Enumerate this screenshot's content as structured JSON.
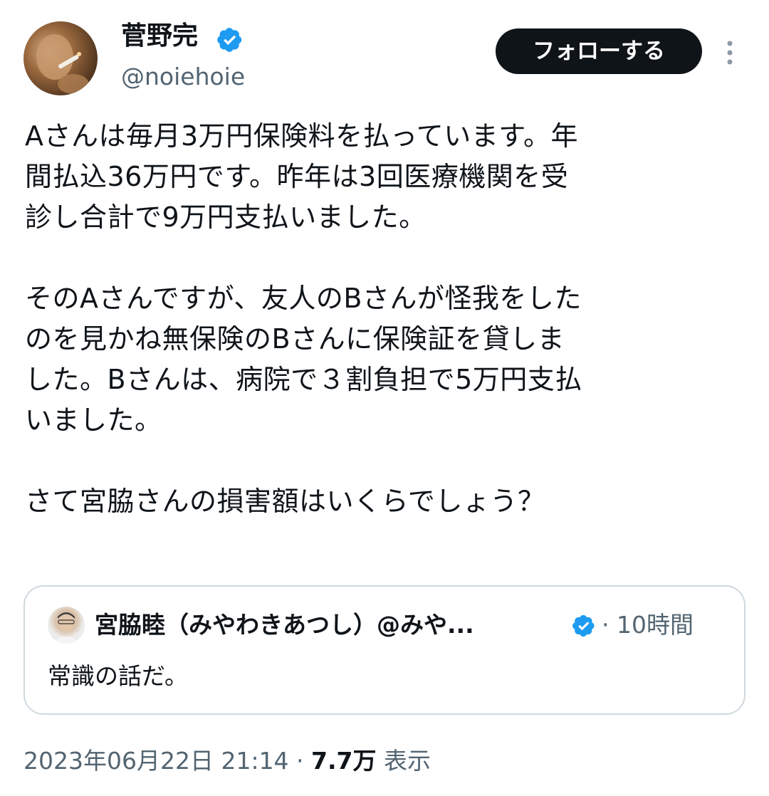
{
  "tweet": {
    "author_name": "菅野完",
    "handle": "@noiehoie",
    "verified": true,
    "follow_label": "フォローする",
    "paragraphs": [
      "Aさんは毎月3万円保険料を払っています。年\n間払込36万円です。昨年は3回医療機関を受\n診し合計で9万円支払いました。",
      "そのAさんですが、友人のBさんが怪我をした\nのを見かね無保険のBさんに保険証を貸しま\nした。Bさんは、病院で３割負担で5万円支払\nいました。",
      "さて宮脇さんの損害額はいくらでしょう？"
    ]
  },
  "quote": {
    "author": "宮脇睦（みやわきあつし）@みや...",
    "verified": true,
    "time": "· 10時間",
    "text": "常識の話だ。"
  },
  "meta": {
    "timestamp": "2023年06月22日 21:14",
    "separator": " · ",
    "views_count": "7.7万",
    "views_label": " 表示"
  },
  "colors": {
    "text": "#0f1419",
    "secondary": "#536471",
    "verified_blue": "#1d9bf0",
    "border": "#cfd9de",
    "follow_bg": "#0f1419"
  },
  "icons": {
    "verified": "verified-badge-icon",
    "more": "more-options-icon"
  }
}
